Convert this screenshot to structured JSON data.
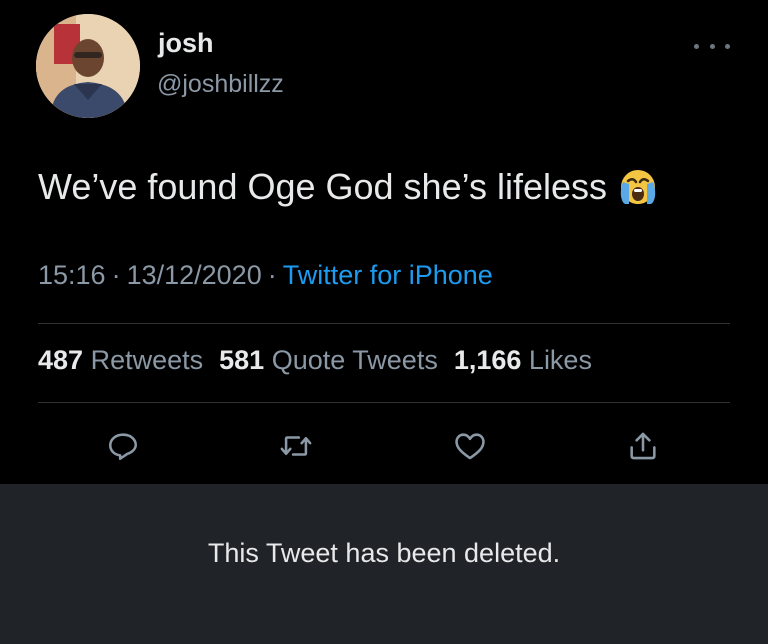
{
  "tweet": {
    "author": {
      "display_name": "josh",
      "handle": "@joshbillzz",
      "avatar_icon": "avatar-photo"
    },
    "more_icon": "more-horizontal-icon",
    "text": "We’ve found Oge God she’s lifeless",
    "emoji": "loudly-crying-face",
    "time": "15:16",
    "date": "13/12/2020",
    "separator": "·",
    "source": "Twitter for iPhone",
    "stats": {
      "retweets_count": "487",
      "retweets_label": "Retweets",
      "quote_count": "581",
      "quote_label": "Quote Tweets",
      "likes_count": "1,166",
      "likes_label": "Likes"
    },
    "actions": [
      {
        "name": "reply",
        "icon": "reply-icon"
      },
      {
        "name": "retweet",
        "icon": "retweet-icon"
      },
      {
        "name": "like",
        "icon": "heart-icon"
      },
      {
        "name": "share",
        "icon": "share-icon"
      }
    ]
  },
  "banner": {
    "message": "This Tweet has been deleted."
  },
  "colors": {
    "background": "#000000",
    "banner_background": "#202327",
    "text_primary": "#e7e9ea",
    "text_secondary": "#8b98a5",
    "link": "#1d9bf0",
    "divider": "#2f3336"
  }
}
